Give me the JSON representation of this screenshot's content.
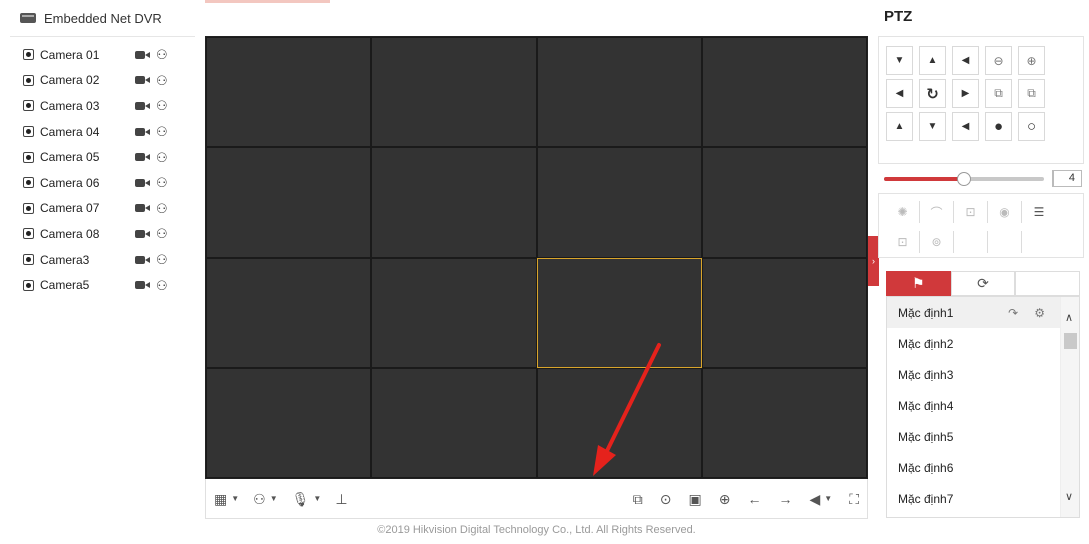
{
  "header": {
    "dvr_title": "Embedded Net DVR"
  },
  "cameras": [
    {
      "name": "Camera 01"
    },
    {
      "name": "Camera 02"
    },
    {
      "name": "Camera 03"
    },
    {
      "name": "Camera 04"
    },
    {
      "name": "Camera 05"
    },
    {
      "name": "Camera 06"
    },
    {
      "name": "Camera 07"
    },
    {
      "name": "Camera 08"
    },
    {
      "name": "Camera3"
    },
    {
      "name": "Camera5"
    }
  ],
  "video_grid": {
    "rows": 4,
    "cols": 4,
    "selected_row": 3,
    "selected_col": 3
  },
  "toolbar": {
    "left": [
      {
        "name": "layout-icon",
        "glyph": "▦",
        "caret": "▼"
      },
      {
        "name": "ptz-stream-icon",
        "glyph": "⚇",
        "caret": "▼"
      },
      {
        "name": "microphone-icon",
        "glyph": "🎙",
        "caret": "▼"
      },
      {
        "name": "stream-select-icon",
        "glyph": "⊥"
      }
    ],
    "right": [
      {
        "name": "stop-all-icon",
        "glyph": "⧉"
      },
      {
        "name": "capture-icon",
        "glyph": "⊙"
      },
      {
        "name": "record-icon",
        "glyph": "▣"
      },
      {
        "name": "zoom-icon",
        "glyph": "⊕"
      },
      {
        "name": "previous-page-icon",
        "glyph": "←"
      },
      {
        "name": "next-page-icon",
        "glyph": "→"
      },
      {
        "name": "volume-icon",
        "glyph": "◀",
        "caret": "▼"
      },
      {
        "name": "fullscreen-icon",
        "glyph": "⛶"
      }
    ]
  },
  "footer": "©2019 Hikvision Digital Technology Co., Ltd. All Rights Reserved.",
  "ptz": {
    "title": "PTZ",
    "buttons": [
      {
        "name": "ptz-up-left-button",
        "glyph": "▼"
      },
      {
        "name": "ptz-up-button",
        "glyph": "▲"
      },
      {
        "name": "ptz-up-right-button",
        "glyph": "◀"
      },
      {
        "name": "zoom-out-button",
        "glyph": "⊖"
      },
      {
        "name": "zoom-in-button",
        "glyph": "⊕"
      },
      {
        "name": "ptz-left-button",
        "glyph": "◀"
      },
      {
        "name": "ptz-auto-button",
        "glyph": "↻"
      },
      {
        "name": "ptz-right-button",
        "glyph": "▶"
      },
      {
        "name": "focus-near-button",
        "glyph": "⧉"
      },
      {
        "name": "focus-far-button",
        "glyph": "⧉"
      },
      {
        "name": "ptz-down-left-button",
        "glyph": "▲"
      },
      {
        "name": "ptz-down-button",
        "glyph": "▼"
      },
      {
        "name": "ptz-down-right-button",
        "glyph": "◀"
      },
      {
        "name": "iris-close-button",
        "glyph": "●"
      },
      {
        "name": "iris-open-button",
        "glyph": "○"
      }
    ],
    "speed": {
      "value": "4",
      "level_fraction": 0.5
    },
    "functions_row1": [
      {
        "name": "light-icon",
        "glyph": "✺"
      },
      {
        "name": "wiper-icon",
        "glyph": "⌒"
      },
      {
        "name": "focus-assist-icon",
        "glyph": "⊡"
      },
      {
        "name": "lens-init-icon",
        "glyph": "◉"
      },
      {
        "name": "menu-icon",
        "glyph": "☰",
        "dark": true
      }
    ],
    "functions_row2": [
      {
        "name": "manual-track-icon",
        "glyph": "⊡"
      },
      {
        "name": "3d-zoom-icon",
        "glyph": "⊚"
      },
      {
        "name": "empty-slot",
        "glyph": ""
      },
      {
        "name": "empty-slot",
        "glyph": ""
      },
      {
        "name": "empty-slot",
        "glyph": ""
      }
    ],
    "tabs": [
      {
        "name": "preset-tab",
        "glyph": "⚑",
        "active": true
      },
      {
        "name": "patrol-tab",
        "glyph": "⟳",
        "active": false
      },
      {
        "name": "pattern-tab",
        "glyph": "",
        "active": false
      }
    ],
    "presets": [
      {
        "label": "Mặc định1",
        "active": true,
        "call": "↷",
        "set": "⚙"
      },
      {
        "label": "Mặc định2"
      },
      {
        "label": "Mặc định3"
      },
      {
        "label": "Mặc định4"
      },
      {
        "label": "Mặc định5"
      },
      {
        "label": "Mặc định6"
      },
      {
        "label": "Mặc định7"
      }
    ],
    "scroll": {
      "up": "∧",
      "down": "∨"
    }
  },
  "colors": {
    "accent": "#d0393b",
    "video_bg": "#333333",
    "selected_border": "#d9a52b"
  }
}
